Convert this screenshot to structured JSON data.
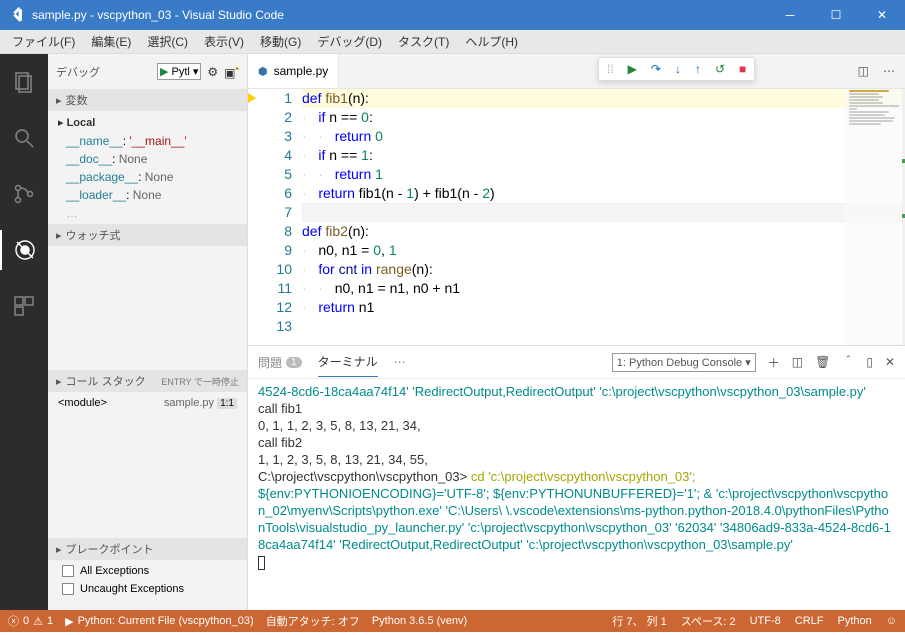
{
  "titlebar": {
    "title": "sample.py - vscpython_03 - Visual Studio Code"
  },
  "menu": [
    "ファイル(F)",
    "編集(E)",
    "選択(C)",
    "表示(V)",
    "移動(G)",
    "デバッグ(D)",
    "タスク(T)",
    "ヘルプ(H)"
  ],
  "sidebar": {
    "debug_label": "デバッグ",
    "config": "Pytl",
    "sections": {
      "vars": "変数",
      "local": "Local",
      "watch": "ウォッチ式",
      "callstack": "コール スタック",
      "callstack_extra": "ENTRY で一時停止",
      "breakpoints": "ブレークポイント"
    },
    "variables": [
      {
        "name": "__name__",
        "value": "'__main__'",
        "kind": "str"
      },
      {
        "name": "__doc__",
        "value": "None",
        "kind": "none"
      },
      {
        "name": "__package__",
        "value": "None",
        "kind": "none"
      },
      {
        "name": "__loader__",
        "value": "None",
        "kind": "none"
      }
    ],
    "callstack": [
      {
        "name": "<module>",
        "file": "sample.py",
        "line": "1:1"
      }
    ],
    "breakpoints": [
      {
        "label": "All Exceptions"
      },
      {
        "label": "Uncaught Exceptions"
      }
    ]
  },
  "tabs": {
    "file": "sample.py"
  },
  "editor": {
    "lines": [
      {
        "n": 1,
        "hl": true,
        "bp": true,
        "html": "<span class='kw'>def</span> <span class='fn'>fib1</span>(n):"
      },
      {
        "n": 2,
        "html": "<span class='guide'>·</span><span class='kw'>if</span> n <span class='op'>==</span> <span class='num'>0</span>:"
      },
      {
        "n": 3,
        "html": "<span class='guide'>··</span><span class='kw'>return</span> <span class='num'>0</span>"
      },
      {
        "n": 4,
        "html": "<span class='guide'>·</span><span class='kw'>if</span> n <span class='op'>==</span> <span class='num'>1</span>:"
      },
      {
        "n": 5,
        "html": "<span class='guide'>··</span><span class='kw'>return</span> <span class='num'>1</span>"
      },
      {
        "n": 6,
        "html": "<span class='guide'>·</span><span class='kw'>return</span> fib1(n <span class='op'>-</span> <span class='num'>1</span>) <span class='op'>+</span> fib1(n <span class='op'>-</span> <span class='num'>2</span>)"
      },
      {
        "n": 7,
        "curr": true,
        "html": ""
      },
      {
        "n": 8,
        "html": "<span class='kw'>def</span> <span class='fn'>fib2</span>(n):"
      },
      {
        "n": 9,
        "html": "<span class='guide'>·</span>n0, n1 <span class='op'>=</span> <span class='num'>0</span>, <span class='num'>1</span>"
      },
      {
        "n": 10,
        "html": "<span class='guide'>·</span><span class='kw'>for</span> <span class='id'>cnt</span> <span class='kw'>in</span> <span class='fn'>range</span>(n):"
      },
      {
        "n": 11,
        "html": "<span class='guide'>··</span>n0, n1 <span class='op'>=</span> n1, n0 <span class='op'>+</span> n1"
      },
      {
        "n": 12,
        "html": "<span class='guide'>·</span><span class='kw'>return</span> n1"
      },
      {
        "n": 13,
        "html": ""
      }
    ]
  },
  "panel": {
    "problems": "問題",
    "problems_count": "1",
    "terminal": "ターミナル",
    "dropdown": "1: Python Debug Console",
    "content": [
      {
        "cls": "term-cyan",
        "text": "4524-8cd6-18ca4aa74f14' 'RedirectOutput,RedirectOutput' 'c:\\project\\vscpython\\vscpython_03\\sample.py'"
      },
      {
        "cls": "",
        "text": "call fib1"
      },
      {
        "cls": "",
        "text": "0, 1, 1, 2, 3, 5, 8, 13, 21, 34,"
      },
      {
        "cls": "",
        "text": "call fib2"
      },
      {
        "cls": "",
        "text": "1, 1, 2, 3, 5, 8, 13, 21, 34, 55,"
      }
    ],
    "prompt": "C:\\project\\vscpython\\vscpython_03>",
    "cmd_cd": "cd 'c:\\project\\vscpython\\vscpython_03';",
    "cmd_rest": "${env:PYTHONIOENCODING}='UTF-8'; ${env:PYTHONUNBUFFERED}='1'; & 'c:\\project\\vscpython\\vscpython_02\\myenv\\Scripts\\python.exe' 'C:\\Users\\        \\.vscode\\extensions\\ms-python.python-2018.4.0\\pythonFiles\\PythonTools\\visualstudio_py_launcher.py' 'c:\\project\\vscpython\\vscpython_03' '62034' '34806ad9-833a-4524-8cd6-18ca4aa74f14' 'RedirectOutput,RedirectOutput' 'c:\\project\\vscpython\\vscpython_03\\sample.py'"
  },
  "statusbar": {
    "errors": "0",
    "warnings": "1",
    "launch": "Python: Current File (vscpython_03)",
    "attach": "自動アタッチ: オフ",
    "python": "Python 3.6.5 (venv)",
    "pos": "行 7、 列 1",
    "spaces": "スペース: 2",
    "encoding": "UTF-8",
    "eol": "CRLF",
    "lang": "Python"
  }
}
